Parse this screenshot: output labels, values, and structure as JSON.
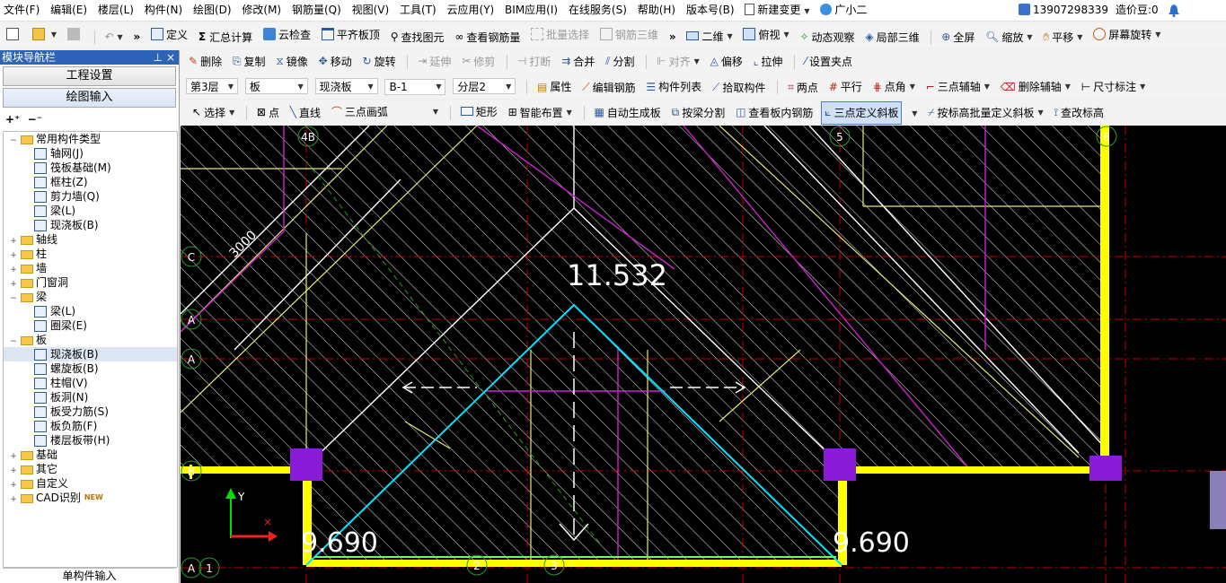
{
  "menubar": {
    "items": [
      "文件(F)",
      "编辑(E)",
      "楼层(L)",
      "构件(N)",
      "绘图(D)",
      "修改(M)",
      "钢筋量(Q)",
      "视图(V)",
      "工具(T)",
      "云应用(Y)",
      "BIM应用(I)",
      "在线服务(S)",
      "帮助(H)",
      "版本号(B)"
    ],
    "new_change": "新建变更",
    "assistant": "广小二",
    "phone": "13907298339",
    "beans_label": "造价豆:0"
  },
  "toolbar1": {
    "items": [
      "定义",
      "汇总计算",
      "云检查",
      "平齐板顶",
      "查找图元",
      "查看钢筋量",
      "批量选择",
      "钢筋三维"
    ],
    "view_dd": "二维",
    "view2": [
      "俯视",
      "动态观察",
      "局部三维",
      "全屏",
      "缩放",
      "平移",
      "屏幕旋转"
    ]
  },
  "toolbar2": {
    "items": [
      "删除",
      "复制",
      "镜像",
      "移动",
      "旋转",
      "延伸",
      "修剪",
      "打断",
      "合并",
      "分割",
      "对齐",
      "偏移",
      "拉伸",
      "设置夹点"
    ]
  },
  "toolbar3": {
    "floor": "第3层",
    "category": "板",
    "type": "现浇板",
    "name": "B-1",
    "layer": "分层2",
    "items": [
      "属性",
      "编辑钢筋",
      "构件列表",
      "拾取构件",
      "两点",
      "平行",
      "点角",
      "三点辅轴",
      "删除辅轴",
      "尺寸标注"
    ]
  },
  "toolbar4": {
    "items": [
      "选择",
      "点",
      "直线",
      "三点画弧",
      "矩形",
      "智能布置",
      "自动生成板",
      "按梁分割",
      "查看板内钢筋",
      "三点定义斜板",
      "按标高批量定义斜板",
      "查改标高"
    ]
  },
  "nav": {
    "title": "模块导航栏",
    "btn_project": "工程设置",
    "btn_draw": "绘图输入",
    "tree": [
      {
        "label": "常用构件类型",
        "level": 0,
        "exp": "−",
        "folder": true
      },
      {
        "label": "轴网(J)",
        "level": 1
      },
      {
        "label": "筏板基础(M)",
        "level": 1
      },
      {
        "label": "框柱(Z)",
        "level": 1
      },
      {
        "label": "剪力墙(Q)",
        "level": 1
      },
      {
        "label": "梁(L)",
        "level": 1
      },
      {
        "label": "现浇板(B)",
        "level": 1
      },
      {
        "label": "轴线",
        "level": 0,
        "exp": "+",
        "folder": true
      },
      {
        "label": "柱",
        "level": 0,
        "exp": "+",
        "folder": true
      },
      {
        "label": "墙",
        "level": 0,
        "exp": "+",
        "folder": true
      },
      {
        "label": "门窗洞",
        "level": 0,
        "exp": "+",
        "folder": true
      },
      {
        "label": "梁",
        "level": 0,
        "exp": "−",
        "folder": true
      },
      {
        "label": "梁(L)",
        "level": 1
      },
      {
        "label": "圈梁(E)",
        "level": 1
      },
      {
        "label": "板",
        "level": 0,
        "exp": "−",
        "folder": true
      },
      {
        "label": "现浇板(B)",
        "level": 1,
        "selected": true
      },
      {
        "label": "螺旋板(B)",
        "level": 1
      },
      {
        "label": "柱帽(V)",
        "level": 1
      },
      {
        "label": "板洞(N)",
        "level": 1
      },
      {
        "label": "板受力筋(S)",
        "level": 1
      },
      {
        "label": "板负筋(F)",
        "level": 1
      },
      {
        "label": "楼层板带(H)",
        "level": 1
      },
      {
        "label": "基础",
        "level": 0,
        "exp": "+",
        "folder": true
      },
      {
        "label": "其它",
        "level": 0,
        "exp": "+",
        "folder": true
      },
      {
        "label": "自定义",
        "level": 0,
        "exp": "+",
        "folder": true
      },
      {
        "label": "CAD识别",
        "level": 0,
        "exp": "+",
        "folder": true,
        "badge": "NEW"
      }
    ],
    "single_input": "单构件输入"
  },
  "canvas": {
    "elev_top": "11.532",
    "elev_left": "9.690",
    "elev_right": "9.690",
    "dim_label": "3000",
    "axis_labels": [
      "4B",
      "5",
      "6",
      "C",
      "A",
      "A",
      "B",
      "1",
      "2",
      "3",
      "A"
    ],
    "ucs_y": "Y"
  },
  "colors": {
    "accent": "#2e64b8",
    "beam": "#ffff00",
    "column": "#8a1bd6",
    "slope": "#00e5ff",
    "hatch": "#ffffff",
    "aux_axis": "#cc0000"
  }
}
